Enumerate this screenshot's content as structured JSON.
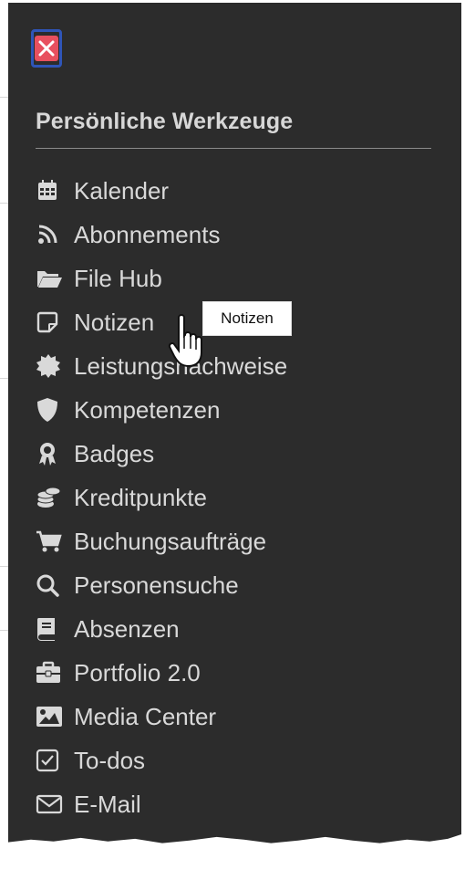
{
  "panel": {
    "title": "Persönliche Werkzeuge",
    "close_icon": "close-x-icon"
  },
  "menu": {
    "items": [
      {
        "label": "Kalender",
        "icon": "calendar-icon"
      },
      {
        "label": "Abonnements",
        "icon": "rss-icon"
      },
      {
        "label": "File Hub",
        "icon": "folder-open-icon"
      },
      {
        "label": "Notizen",
        "icon": "note-icon"
      },
      {
        "label": "Leistungsnachweise",
        "icon": "certificate-seal-icon"
      },
      {
        "label": "Kompetenzen",
        "icon": "shield-icon"
      },
      {
        "label": "Badges",
        "icon": "award-icon"
      },
      {
        "label": "Kreditpunkte",
        "icon": "coins-icon"
      },
      {
        "label": "Buchungsaufträge",
        "icon": "cart-icon"
      },
      {
        "label": "Personensuche",
        "icon": "search-icon"
      },
      {
        "label": "Absenzen",
        "icon": "book-icon"
      },
      {
        "label": "Portfolio 2.0",
        "icon": "briefcase-icon"
      },
      {
        "label": "Media Center",
        "icon": "image-icon"
      },
      {
        "label": "To-dos",
        "icon": "checkbox-icon"
      },
      {
        "label": "E-Mail",
        "icon": "envelope-icon"
      }
    ]
  },
  "tooltip": {
    "text": "Notizen"
  },
  "colors": {
    "panel_bg": "#2c2c2c",
    "text": "#d9d9d9",
    "close_border": "#2f55b8",
    "close_bg": "#e8505f"
  }
}
